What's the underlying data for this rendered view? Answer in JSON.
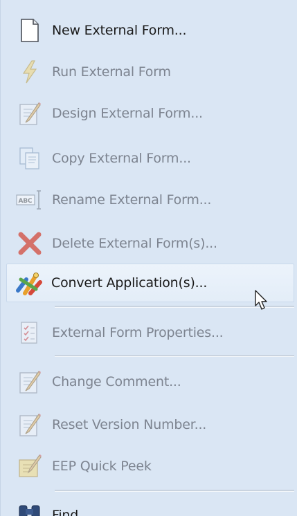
{
  "menu": {
    "items": [
      {
        "label": "New External Form...",
        "icon": "new-document-icon",
        "enabled": true
      },
      {
        "label": "Run External Form",
        "icon": "lightning-icon",
        "enabled": false
      },
      {
        "label": "Design External Form...",
        "icon": "pencil-document-icon",
        "enabled": false
      },
      {
        "label": "Copy External Form...",
        "icon": "copy-icon",
        "enabled": false
      },
      {
        "label": "Rename External Form...",
        "icon": "rename-icon",
        "enabled": false
      },
      {
        "label": "Delete External Form(s)...",
        "icon": "delete-x-icon",
        "enabled": false
      },
      {
        "label": "Convert Application(s)...",
        "icon": "convert-icon",
        "enabled": true,
        "highlighted": true
      },
      {
        "label": "External Form Properties...",
        "icon": "properties-checklist-icon",
        "enabled": false
      },
      {
        "label": "Change Comment...",
        "icon": "pencil-document-icon",
        "enabled": false
      },
      {
        "label": "Reset Version Number...",
        "icon": "pencil-document-icon",
        "enabled": false
      },
      {
        "label": "EEP Quick Peek",
        "icon": "quick-peek-icon",
        "enabled": false
      },
      {
        "label": "Find",
        "icon": "binoculars-icon",
        "enabled": true
      }
    ]
  },
  "colors": {
    "background": "#dae6f4",
    "text_enabled": "#1a1a1a",
    "text_disabled": "#7d8490",
    "delete_red": "#d24b3c"
  }
}
